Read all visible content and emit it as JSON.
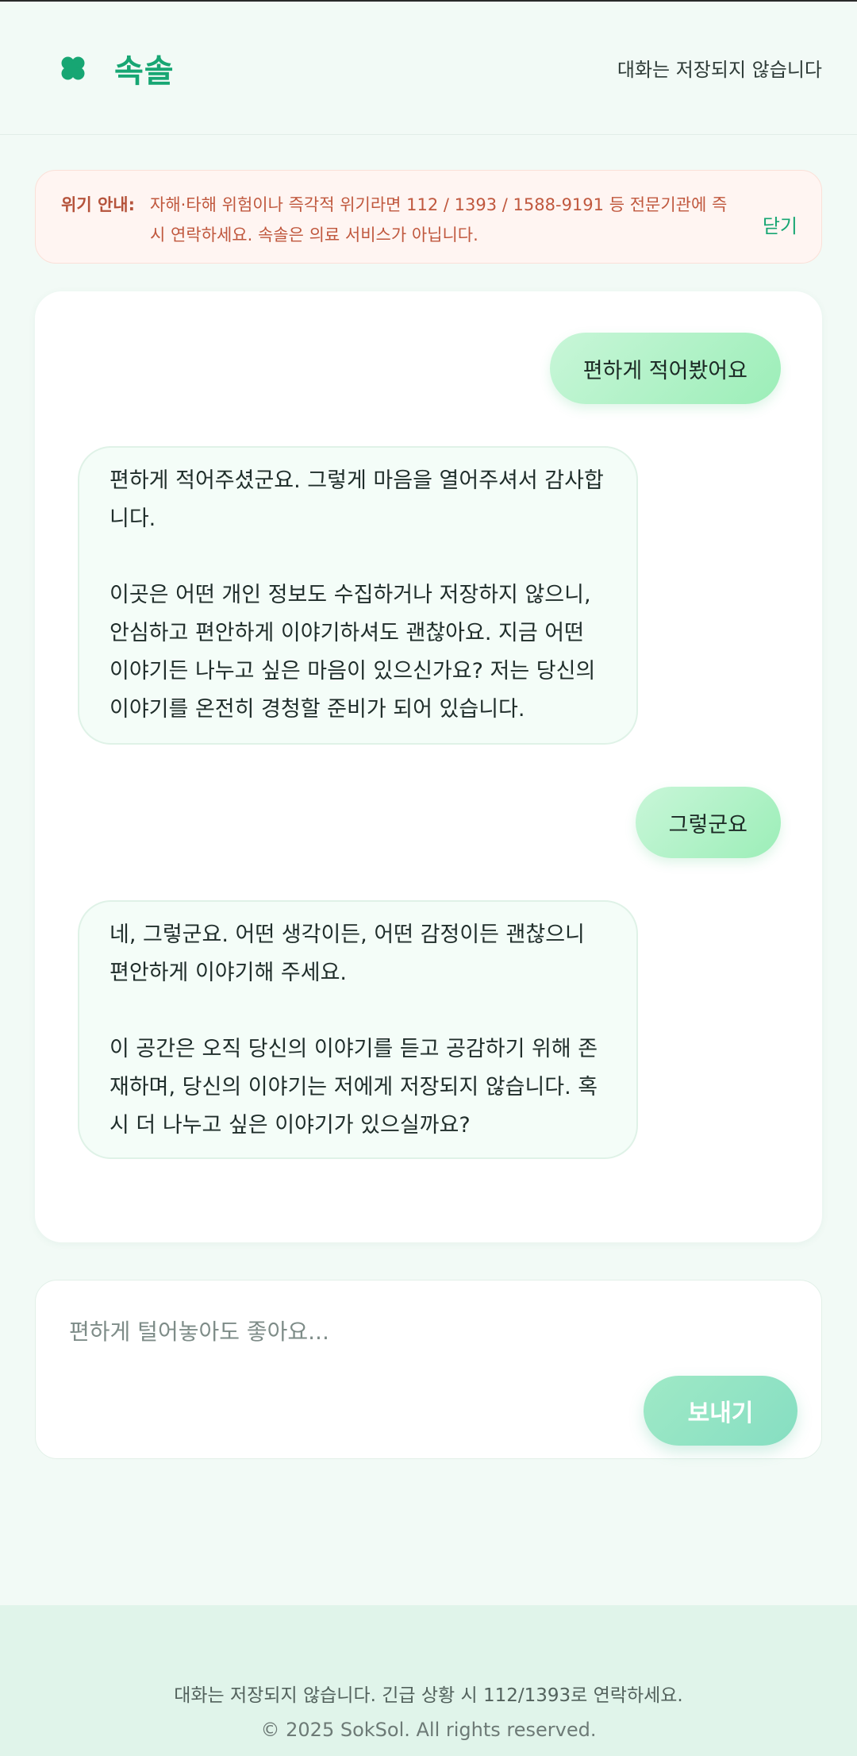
{
  "header": {
    "brand_icon": "clover-icon",
    "brand_name": "속솔",
    "privacy_note": "대화는 저장되지 않습니다"
  },
  "crisis_banner": {
    "label": "위기 안내:",
    "text": "자해·타해 위험이나 즉각적 위기라면 112 / 1393 / 1588-9191 등 전문기관에 즉시 연락하세요. 속솔은 의료 서비스가 아닙니다.",
    "close_label": "닫기"
  },
  "messages": [
    {
      "role": "user",
      "text": "편하게 적어봤어요"
    },
    {
      "role": "bot",
      "text": "편하게 적어주셨군요. 그렇게 마음을 열어주셔서 감사합니다.\n\n이곳은 어떤 개인 정보도 수집하거나 저장하지 않으니, 안심하고 편안하게 이야기하셔도 괜찮아요. 지금 어떤 이야기든 나누고 싶은 마음이 있으신가요? 저는 당신의 이야기를 온전히 경청할 준비가 되어 있습니다."
    },
    {
      "role": "user",
      "text": "그렇군요"
    },
    {
      "role": "bot",
      "text": "네, 그렇군요. 어떤 생각이든, 어떤 감정이든 괜찮으니 편안하게 이야기해 주세요.\n\n이 공간은 오직 당신의 이야기를 듣고 공감하기 위해 존재하며, 당신의 이야기는 저에게 저장되지 않습니다. 혹시 더 나누고 싶은 이야기가 있으실까요?"
    }
  ],
  "composer": {
    "placeholder": "편하게 털어놓아도 좋아요...",
    "value": "",
    "send_label": "보내기"
  },
  "footer": {
    "note": "대화는 저장되지 않습니다. 긴급 상황 시 112/1393로 연락하세요.",
    "copyright": "© 2025 SokSol. All rights reserved."
  },
  "colors": {
    "accent": "#17a673",
    "background": "#f2faf6",
    "user_bubble": "#b4f2cb",
    "bot_bubble": "#f4fdf8",
    "crisis_bg": "#fff5f2",
    "crisis_text": "#c0583e",
    "send_button": "#93e4c4",
    "footer_bg": "#e0f4ea"
  }
}
